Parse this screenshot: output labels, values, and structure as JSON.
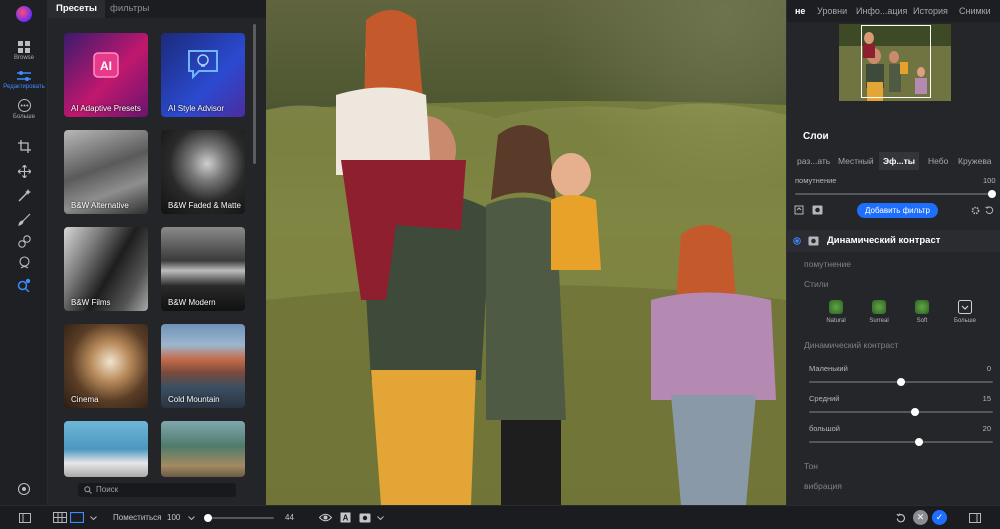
{
  "toolbar": {
    "browse_label": "Browse",
    "edit_label": "Редактировать",
    "more_label": "Больше",
    "accent": "#3c8bff"
  },
  "presets_panel": {
    "tabs": [
      "Пресеты",
      "фильтры"
    ],
    "search_placeholder": "Поиск",
    "tiles": [
      {
        "label": "AI Adaptive Presets",
        "icon": "ai-chip-icon"
      },
      {
        "label": "AI Style Advisor",
        "icon": "lightbulb-chat-icon"
      },
      {
        "label": "B&W Alternative"
      },
      {
        "label": "B&W Faded & Matte"
      },
      {
        "label": "B&W Films"
      },
      {
        "label": "B&W Modern"
      },
      {
        "label": "Cinema"
      },
      {
        "label": "Cold Mountain"
      },
      {
        "label": ""
      },
      {
        "label": ""
      }
    ]
  },
  "right_panel": {
    "tabs": [
      "не",
      "Уровни",
      "Инфо...ация",
      "История",
      "Снимки"
    ],
    "layers_title": "Слои",
    "layer_tabs": [
      "раз...ать",
      "Местный",
      "Эф...ты",
      "Небо",
      "Кружева"
    ],
    "opacity_label": "помутнение",
    "opacity_value": "100",
    "opacity_fraction": 1.0,
    "add_filter_label": "Добавить фильтр",
    "filter_name": "Динамический контраст",
    "filter_opacity_label": "помутнение",
    "styles_label": "Стили",
    "styles": [
      "Natural",
      "Surreal",
      "Soft",
      "Больше"
    ],
    "dynamic_contrast_label": "Динамический контраст",
    "sliders": [
      {
        "label": "Маленький",
        "value": "0",
        "fraction": 0.5
      },
      {
        "label": "Средний",
        "value": "15",
        "fraction": 0.575
      },
      {
        "label": "большой",
        "value": "20",
        "fraction": 0.6
      }
    ],
    "tone_label": "Тон",
    "vibrance_label": "вибрация"
  },
  "bottom_bar": {
    "fit_label": "Поместиться",
    "zoom_value": "100",
    "size_value": "44",
    "size_fraction": 0.05
  }
}
